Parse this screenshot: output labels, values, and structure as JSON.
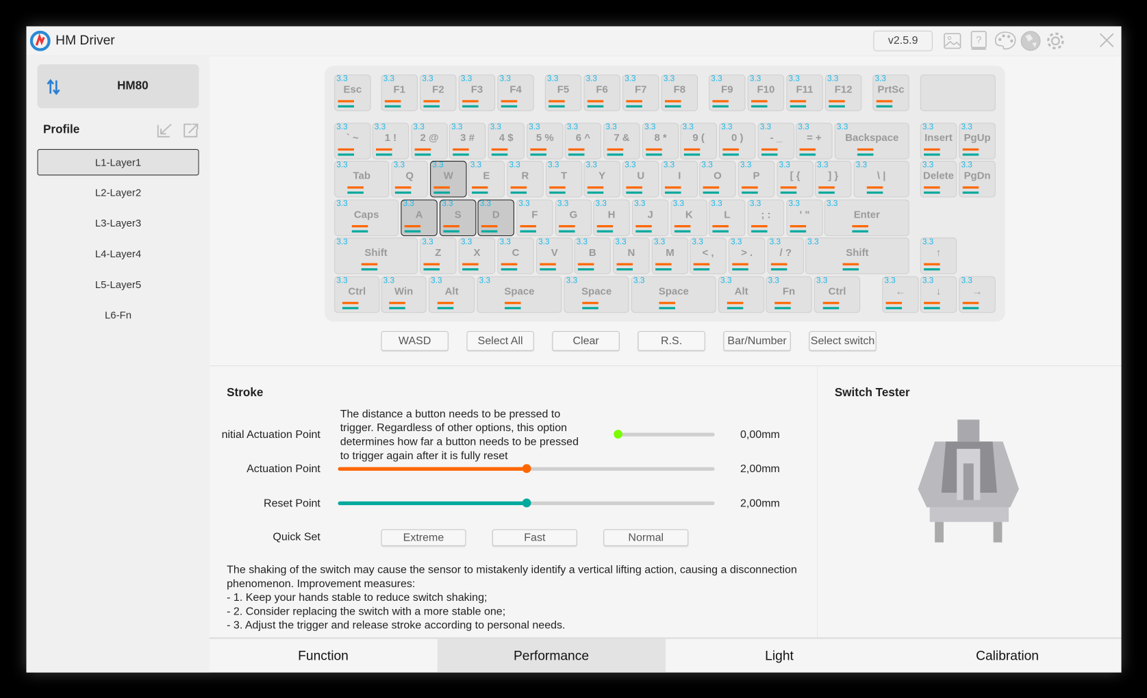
{
  "app": {
    "title": "HM Driver",
    "version": "v2.5.9",
    "icons": [
      "image-icon",
      "help-book-icon",
      "palette-icon",
      "globe-icon",
      "gear-icon",
      "close-icon"
    ]
  },
  "sidebar": {
    "device": "HM80",
    "profile_label": "Profile",
    "layers": [
      {
        "label": "L1-Layer1",
        "selected": true
      },
      {
        "label": "L2-Layer2"
      },
      {
        "label": "L3-Layer3"
      },
      {
        "label": "L4-Layer4"
      },
      {
        "label": "L5-Layer5"
      },
      {
        "label": "L6-Fn"
      }
    ]
  },
  "keyboard": {
    "key_value": "3.3",
    "selected_keys": [
      "W",
      "A",
      "S",
      "D"
    ],
    "rows": [
      [
        "Esc",
        "F1",
        "F2",
        "F3",
        "F4",
        "F5",
        "F6",
        "F7",
        "F8",
        "F9",
        "F10",
        "F11",
        "F12",
        "PrtSc",
        ""
      ],
      [
        "` ~",
        "1 !",
        "2 @",
        "3 #",
        "4 $",
        "5 %",
        "6 ^",
        "7 &",
        "8 *",
        "9 (",
        "0 )",
        "- _",
        "= +",
        "Backspace",
        "Insert",
        "PgUp"
      ],
      [
        "Tab",
        "Q",
        "W",
        "E",
        "R",
        "T",
        "Y",
        "U",
        "I",
        "O",
        "P",
        "[ {",
        "] }",
        "\\ |",
        "Delete",
        "PgDn"
      ],
      [
        "Caps",
        "A",
        "S",
        "D",
        "F",
        "G",
        "H",
        "J",
        "K",
        "L",
        "; :",
        "' \"",
        "Enter"
      ],
      [
        "Shift",
        "Z",
        "X",
        "C",
        "V",
        "B",
        "N",
        "M",
        "< ,",
        "> .",
        "/ ?",
        "Shift",
        "↑"
      ],
      [
        "Ctrl",
        "Win",
        "Alt",
        "Space",
        "Space",
        "Space",
        "Alt",
        "Fn",
        "Ctrl",
        "←",
        "↓",
        "→"
      ]
    ],
    "colors": {
      "value": "#1ab8e8",
      "actuation": "#ff6600",
      "reset": "#00a99d"
    }
  },
  "actions": [
    "WASD",
    "Select All",
    "Clear",
    "R.S.",
    "Bar/Number",
    "Select switch"
  ],
  "stroke": {
    "title": "Stroke",
    "tooltip": "The distance a button needs to be pressed to trigger. Regardless of other options, this option determines how far a button needs to be pressed to trigger again after it is fully reset",
    "initial": {
      "label": "nitial Actuation Point",
      "value": "0,00mm",
      "fraction": 0,
      "color": "#7cfc00"
    },
    "actuation": {
      "label": "Actuation Point",
      "value": "2,00mm",
      "fraction": 0.5,
      "color": "#ff6600"
    },
    "reset": {
      "label": "Reset Point",
      "value": "2,00mm",
      "fraction": 0.5,
      "color": "#00a99d"
    },
    "quick_set": {
      "label": "Quick Set",
      "options": [
        "Extreme",
        "Fast",
        "Normal"
      ]
    },
    "note": [
      "The shaking of the switch may cause the sensor to mistakenly identify a vertical lifting action, causing a disconnection phenomenon. Improvement measures:",
      "- 1. Keep your hands stable to reduce switch shaking;",
      "- 2. Consider replacing the switch with a more stable one;",
      "- 3. Adjust the trigger and release stroke according to personal needs."
    ]
  },
  "switch_tester": {
    "title": "Switch Tester"
  },
  "tabs": [
    {
      "label": "Function"
    },
    {
      "label": "Performance",
      "active": true
    },
    {
      "label": "Light"
    },
    {
      "label": "Calibration"
    }
  ]
}
